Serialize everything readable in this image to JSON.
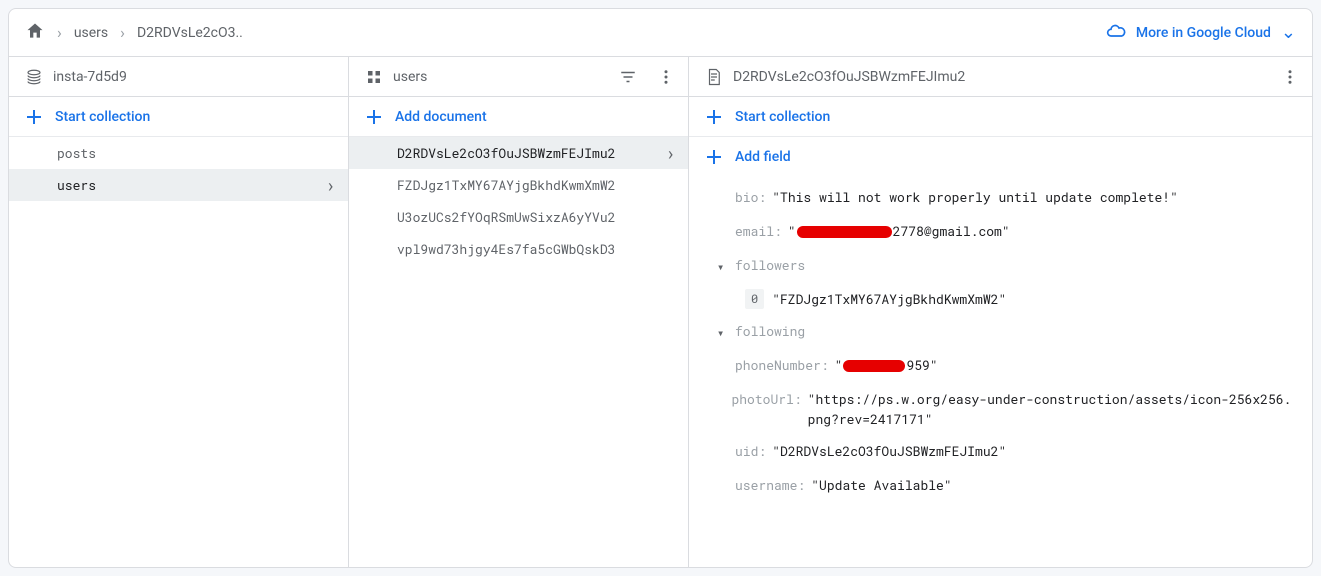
{
  "topbar": {
    "breadcrumb": {
      "level1": "users",
      "level2": "D2RDVsLe2cO3.."
    },
    "cloud_link": "More in Google Cloud"
  },
  "root_panel": {
    "title": "insta-7d5d9",
    "start_collection": "Start collection",
    "collections": [
      {
        "name": "posts",
        "selected": false
      },
      {
        "name": "users",
        "selected": true
      }
    ]
  },
  "collection_panel": {
    "title": "users",
    "add_document": "Add document",
    "documents": [
      {
        "id": "D2RDVsLe2cO3fOuJSBWzmFEJImu2",
        "selected": true
      },
      {
        "id": "FZDJgz1TxMY67AYjgBkhdKwmXmW2",
        "selected": false
      },
      {
        "id": "U3ozUCs2fYOqRSmUwSixzA6yYVu2",
        "selected": false
      },
      {
        "id": "vpl9wd73hjgy4Es7fa5cGWbQskD3",
        "selected": false
      }
    ]
  },
  "document_panel": {
    "title": "D2RDVsLe2cO3fOuJSBWzmFEJImu2",
    "start_collection": "Start collection",
    "add_field": "Add field",
    "fields": {
      "bio_key": "bio",
      "bio_val": "\"This will not work properly until update complete!\"",
      "email_key": "email",
      "email_prefix": "\"",
      "email_suffix": "2778@gmail.com\"",
      "followers_key": "followers",
      "followers_item_index": "0",
      "followers_item_value": "\"FZDJgz1TxMY67AYjgBkhdKwmXmW2\"",
      "following_key": "following",
      "phone_key": "phoneNumber",
      "phone_prefix": "\"",
      "phone_suffix": "959\"",
      "photo_key": "photoUrl",
      "photo_val": "\"https://ps.w.org/easy-under-construction/assets/icon-256x256.png?rev=2417171\"",
      "uid_key": "uid",
      "uid_val": "\"D2RDVsLe2cO3fOuJSBWzmFEJImu2\"",
      "username_key": "username",
      "username_val": "\"Update Available\""
    }
  }
}
